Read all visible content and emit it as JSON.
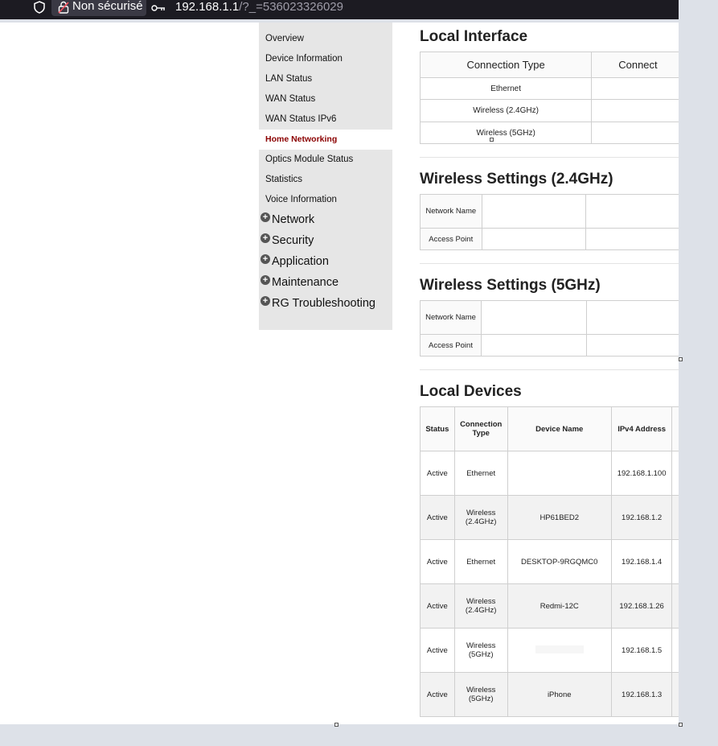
{
  "browser": {
    "security_label": "Non sécurisé",
    "url_host": "192.168.1.1",
    "url_query": "/?_=536023326029"
  },
  "sidebar": {
    "items": [
      {
        "label": "Overview"
      },
      {
        "label": "Device Information"
      },
      {
        "label": "LAN Status"
      },
      {
        "label": "WAN Status"
      },
      {
        "label": "WAN Status IPv6"
      },
      {
        "label": "Home Networking",
        "active": true
      },
      {
        "label": "Optics Module Status"
      },
      {
        "label": "Statistics"
      },
      {
        "label": "Voice Information"
      }
    ],
    "groups": [
      {
        "label": "Network"
      },
      {
        "label": "Security"
      },
      {
        "label": "Application"
      },
      {
        "label": "Maintenance"
      },
      {
        "label": "RG Troubleshooting"
      }
    ]
  },
  "local_interface": {
    "title": "Local Interface",
    "headers": [
      "Connection Type",
      "Connect"
    ],
    "rows": [
      "Ethernet",
      "Wireless (2.4GHz)",
      "Wireless (5GHz)"
    ]
  },
  "wireless_24": {
    "title": "Wireless Settings (2.4GHz)",
    "network_name_label": "Network Name",
    "access_point_label": "Access Point"
  },
  "wireless_5": {
    "title": "Wireless Settings (5GHz)",
    "network_name_label": "Network Name",
    "access_point_label": "Access Point"
  },
  "local_devices": {
    "title": "Local Devices",
    "headers": {
      "status": "Status",
      "connection_type": "Connection Type",
      "device_name": "Device Name",
      "ipv4": "IPv4 Address"
    },
    "rows": [
      {
        "status": "Active",
        "type": "Ethernet",
        "name": "",
        "ip": "192.168.1.100"
      },
      {
        "status": "Active",
        "type": "Wireless (2.4GHz)",
        "name": "HP61BED2",
        "ip": "192.168.1.2"
      },
      {
        "status": "Active",
        "type": "Ethernet",
        "name": "DESKTOP-9RGQMC0",
        "ip": "192.168.1.4"
      },
      {
        "status": "Active",
        "type": "Wireless (2.4GHz)",
        "name": "Redmi-12C",
        "ip": "192.168.1.26"
      },
      {
        "status": "Active",
        "type": "Wireless (5GHz)",
        "name": "",
        "ip": "192.168.1.5"
      },
      {
        "status": "Active",
        "type": "Wireless (5GHz)",
        "name": "iPhone",
        "ip": "192.168.1.3"
      }
    ]
  },
  "colors": {
    "active_nav": "#8b0000",
    "sidebar_bg": "#e6e6e6",
    "topbar_bg": "#1c1b22"
  }
}
